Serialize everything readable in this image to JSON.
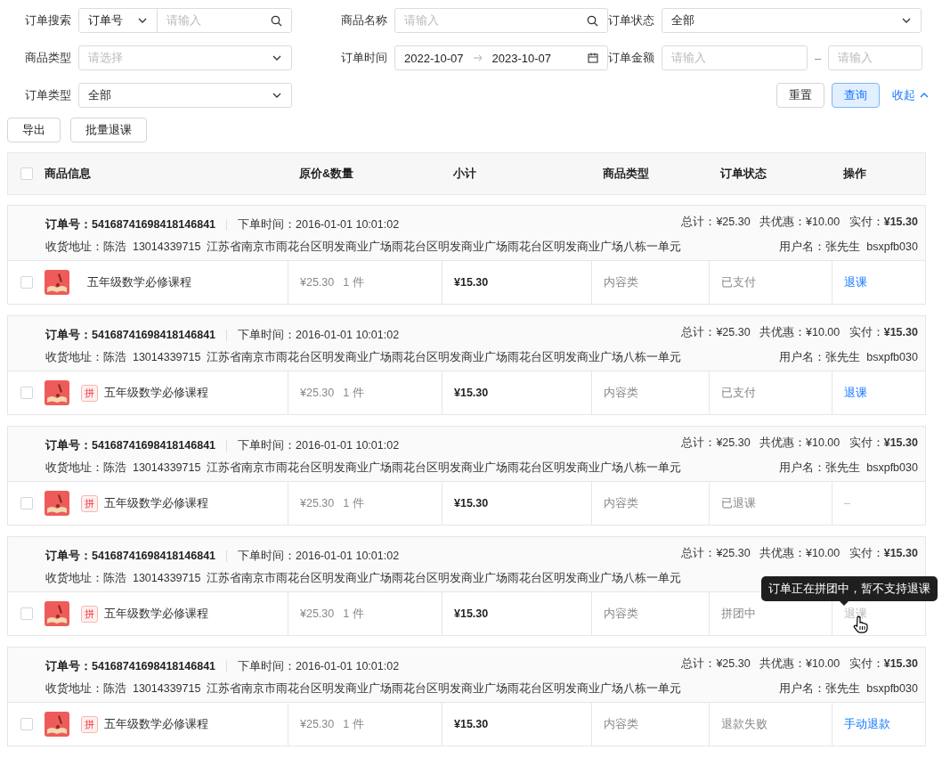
{
  "filters": {
    "row1": [
      {
        "label": "订单搜索",
        "kind": "search_select",
        "select": "订单号",
        "placeholder": "请输入"
      },
      {
        "label": "商品名称",
        "kind": "search",
        "placeholder": "请输入"
      },
      {
        "label": "订单状态",
        "kind": "select",
        "value": "全部"
      }
    ],
    "row2": [
      {
        "label": "商品类型",
        "kind": "select",
        "placeholder": "请选择"
      },
      {
        "label": "订单时间",
        "kind": "range_date",
        "from": "2022-10-07",
        "to": "2023-10-07"
      },
      {
        "label": "订单金额",
        "kind": "range",
        "placeholder_from": "请输入",
        "separator": "–",
        "placeholder_to": "请输入"
      }
    ],
    "row3": [
      {
        "label": "订单类型",
        "kind": "select",
        "value": "全部"
      }
    ],
    "reset": "重置",
    "query": "查询",
    "collapse": "收起"
  },
  "toolbar": [
    "导出",
    "批量退课"
  ],
  "table": {
    "checked": false,
    "columns": [
      "商品信息",
      "原价&数量",
      "小计",
      "商品类型",
      "订单状态",
      "操作"
    ]
  },
  "orders": [
    {
      "order_no": "订单号：54168741698418146841",
      "time": "下单时间：2016-01-01 10:01:02",
      "address": "收货地址：陈浩  13014339715  江苏省南京市雨花台区明发商业广场雨花台区明发商业广场雨花台区明发商业广场八栋一单元",
      "totals": "总计：¥25.30   共优惠：¥10.00   实付：**¥15.30**",
      "user": "用户名：张先生  bsxpfb030",
      "item": {
        "checked": false,
        "name": "五年级数学必修课程",
        "price": "¥25.30",
        "qty": "1 件",
        "subtotal": "¥15.30",
        "type": "内容类",
        "status": "已支付",
        "action": {
          "kind": "link",
          "text": "退课"
        }
      }
    },
    {
      "order_no": "订单号：54168741698418146841",
      "time": "下单时间：2016-01-01 10:01:02",
      "address": "收货地址：陈浩  13014339715  江苏省南京市雨花台区明发商业广场雨花台区明发商业广场雨花台区明发商业广场八栋一单元",
      "totals": "总计：¥25.30   共优惠：¥10.00   实付：**¥15.30**",
      "user": "用户名：张先生  bsxpfb030",
      "item": {
        "checked": false,
        "tag": "拼",
        "name": "五年级数学必修课程",
        "price": "¥25.30",
        "qty": "1 件",
        "subtotal": "¥15.30",
        "type": "内容类",
        "status": "已支付",
        "action": {
          "kind": "link",
          "text": "退课"
        }
      }
    },
    {
      "order_no": "订单号：54168741698418146841",
      "time": "下单时间：2016-01-01 10:01:02",
      "address": "收货地址：陈浩  13014339715  江苏省南京市雨花台区明发商业广场雨花台区明发商业广场雨花台区明发商业广场八栋一单元",
      "totals": "总计：¥25.30   共优惠：¥10.00   实付：**¥15.30**",
      "user": "用户名：张先生  bsxpfb030",
      "item": {
        "checked": false,
        "tag": "拼",
        "name": "五年级数学必修课程",
        "price": "¥25.30",
        "qty": "1 件",
        "subtotal": "¥15.30",
        "type": "内容类",
        "status": "已退课",
        "action": {
          "kind": "none",
          "text": "–"
        }
      }
    },
    {
      "order_no": "订单号：54168741698418146841",
      "time": "下单时间：2016-01-01 10:01:02",
      "address": "收货地址：陈浩  13014339715  江苏省南京市雨花台区明发商业广场雨花台区明发商业广场雨花台区明发商业广场八栋一单元",
      "totals": "总计：¥25.30   共优惠：¥10.00   实付：**¥15.30**",
      "item": {
        "checked": false,
        "tag": "拼",
        "name": "五年级数学必修课程",
        "price": "¥25.30",
        "qty": "1 件",
        "subtotal": "¥15.30",
        "type": "内容类",
        "status": "拼团中",
        "action": {
          "kind": "disabled",
          "text": "退课",
          "tooltip": "订单正在拼团中，暂不支持退课"
        }
      }
    },
    {
      "order_no": "订单号：54168741698418146841",
      "time": "下单时间：2016-01-01 10:01:02",
      "address": "收货地址：陈浩  13014339715  江苏省南京市雨花台区明发商业广场雨花台区明发商业广场雨花台区明发商业广场八栋一单元",
      "totals": "总计：¥25.30   共优惠：¥10.00   实付：**¥15.30**",
      "user": "用户名：张先生  bsxpfb030",
      "item": {
        "checked": false,
        "tag": "拼",
        "name": "五年级数学必修课程",
        "price": "¥25.30",
        "qty": "1 件",
        "subtotal": "¥15.30",
        "type": "内容类",
        "status": "退款失败",
        "action": {
          "kind": "link",
          "text": "手动退款"
        }
      }
    }
  ]
}
